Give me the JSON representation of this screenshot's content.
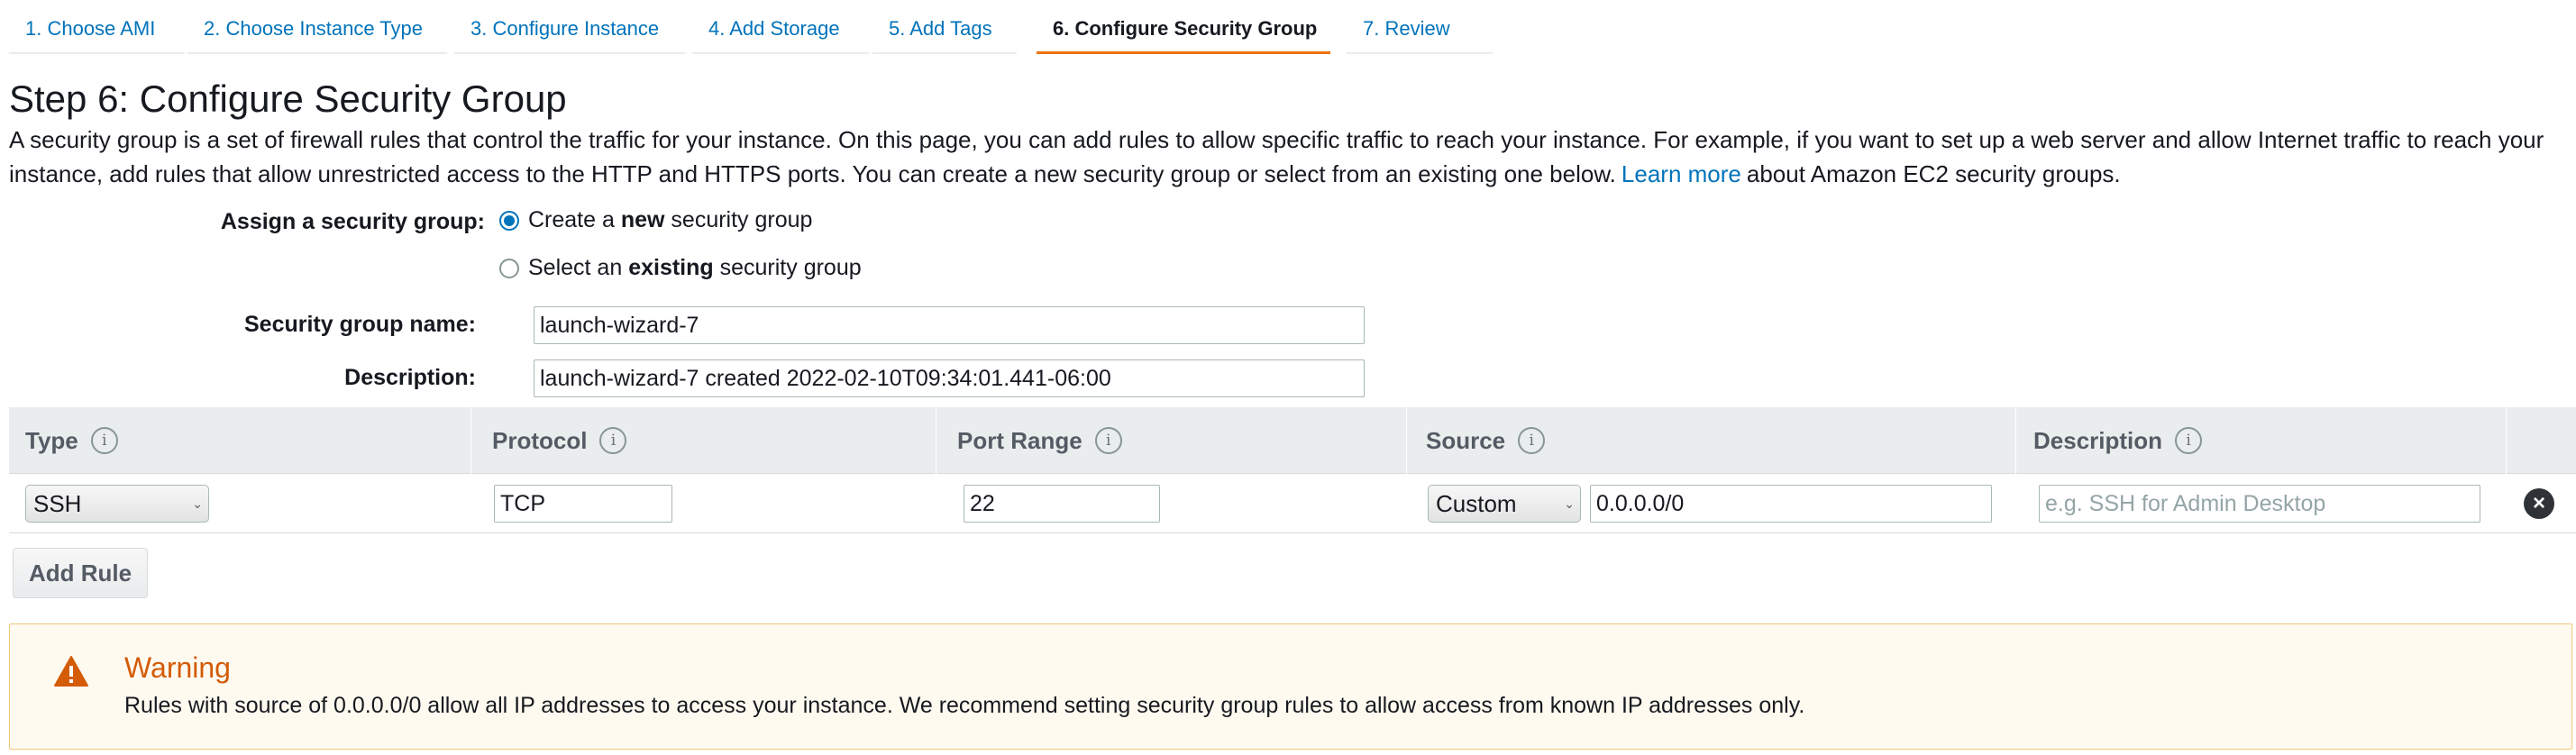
{
  "tabs": [
    {
      "label": "1. Choose AMI"
    },
    {
      "label": "2. Choose Instance Type"
    },
    {
      "label": "3. Configure Instance"
    },
    {
      "label": "4. Add Storage"
    },
    {
      "label": "5. Add Tags"
    },
    {
      "label": "6. Configure Security Group",
      "active": true
    },
    {
      "label": "7. Review"
    }
  ],
  "page": {
    "title": "Step 6: Configure Security Group",
    "intro_text": "A security group is a set of firewall rules that control the traffic for your instance. On this page, you can add rules to allow specific traffic to reach your instance. For example, if you want to set up a web server and allow Internet traffic to reach your instance, add rules that allow unrestricted access to the HTTP and HTTPS ports. You can create a new security group or select from an existing one below.",
    "learn_more": "Learn more",
    "intro_suffix": "about Amazon EC2 security groups."
  },
  "assign": {
    "label": "Assign a security group:",
    "option_new_prefix": "Create a ",
    "option_new_bold": "new",
    "option_new_suffix": " security group",
    "option_existing_prefix": "Select an ",
    "option_existing_bold": "existing",
    "option_existing_suffix": " security group",
    "selected": "new"
  },
  "sg_name": {
    "label": "Security group name:",
    "value": "launch-wizard-7"
  },
  "sg_description": {
    "label": "Description:",
    "value": "launch-wizard-7 created 2022-02-10T09:34:01.441-06:00"
  },
  "table": {
    "headers": [
      "Type",
      "Protocol",
      "Port Range",
      "Source",
      "Description"
    ],
    "info_glyph": "i",
    "rows": [
      {
        "type": "SSH",
        "protocol": "TCP",
        "port_range": "22",
        "source_mode": "Custom",
        "source_value": "0.0.0.0/0",
        "description_placeholder": "e.g. SSH for Admin Desktop"
      }
    ]
  },
  "add_rule_label": "Add Rule",
  "warning": {
    "title": "Warning",
    "text": "Rules with source of 0.0.0.0/0 allow all IP addresses to access your instance. We recommend setting security group rules to allow access from known IP addresses only."
  },
  "colors": {
    "link": "#0073bb",
    "active_tab_underline": "#ec7211",
    "warning_title": "#d45b07",
    "warning_bg": "#fffaf0",
    "warning_border": "#f0c87c",
    "header_bg": "#eaeded"
  },
  "icons": {
    "remove_rule": "close-circle-icon",
    "warning": "warning-triangle-icon",
    "info": "info-icon",
    "select_chevron": "chevron-down-icon"
  }
}
